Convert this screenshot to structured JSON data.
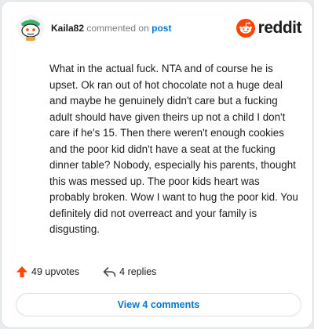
{
  "header": {
    "username": "Kaila82",
    "action": "commented on",
    "target": "post",
    "brand": "reddit"
  },
  "comment": {
    "text": "What in the actual fuck. NTA and of course he is upset. Ok ran out of hot chocolate not a huge deal and maybe he genuinely didn't care but a fucking adult should have given theirs up not a child I don't care if he's 15. Then there weren't enough cookies and the poor kid didn't have a seat at the fucking dinner table? Nobody, especially his parents, thought this was messed up. The poor kids heart was probably broken. Wow I want to hug the poor kid. You definitely did not overreact and your family is disgusting."
  },
  "footer": {
    "upvotes": "49 upvotes",
    "replies": "4 replies"
  },
  "view_comments_label": "View 4 comments",
  "colors": {
    "accent": "#0079d3",
    "upvote": "#ff4500",
    "brand": "#ff4500"
  }
}
